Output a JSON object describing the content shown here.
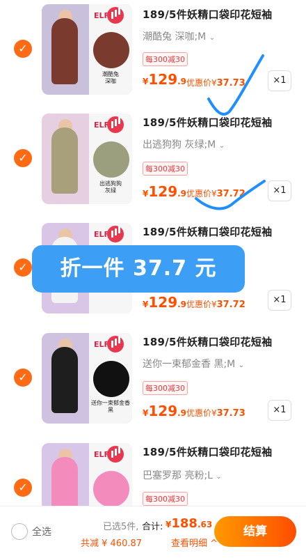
{
  "items": [
    {
      "title": "189/5件妖精口袋印花短袖",
      "spec": "潮酷兔 深咖;M",
      "promo": "每300减30",
      "price_currency": "¥",
      "price_int": "129",
      "price_dec": ".9",
      "discount_label": "优惠价¥",
      "discount_val": "37.73",
      "qty": "×1",
      "thumb_caption": "潮酷兔\n深咖",
      "brand": "ELF",
      "shirt_color": "#7a3b2e",
      "circle_color": "#7a3b2e",
      "bg_color": "#c9c0dc"
    },
    {
      "title": "189/5件妖精口袋印花短袖",
      "spec": "出逃狗狗 灰绿;M",
      "promo": "每300减30",
      "price_currency": "¥",
      "price_int": "129",
      "price_dec": ".9",
      "discount_label": "优惠价¥",
      "discount_val": "37.72",
      "qty": "×1",
      "thumb_caption": "出逃狗狗\n灰绿",
      "brand": "ELF",
      "shirt_color": "#a7a07a",
      "circle_color": "#9c9f7e",
      "bg_color": "#e6cfe0"
    },
    {
      "title": "189/5件妖精口袋印花短袖",
      "spec": "",
      "promo": "",
      "price_currency": "¥",
      "price_int": "129",
      "price_dec": ".9",
      "discount_label": "优惠价¥",
      "discount_val": "37.72",
      "qty": "×1",
      "thumb_caption": "",
      "brand": "ELF",
      "shirt_color": "#f3f3f3",
      "circle_color": "#ffffff",
      "bg_color": "#d9c6e6"
    },
    {
      "title": "189/5件妖精口袋印花短袖",
      "spec": "送你一束郁金香 黑;M",
      "promo": "每300减30",
      "price_currency": "¥",
      "price_int": "129",
      "price_dec": ".9",
      "discount_label": "优惠价¥",
      "discount_val": "37.73",
      "qty": "×1",
      "thumb_caption": "送你一束郁金香\n黑",
      "brand": "ELF",
      "shirt_color": "#1e1e1e",
      "circle_color": "#111111",
      "bg_color": "#cfc2e0"
    },
    {
      "title": "189/5件妖精口袋印花短袖",
      "spec": "巴塞罗那 亮粉;L",
      "promo": "每300减30",
      "price_currency": "",
      "price_int": "",
      "price_dec": "",
      "discount_label": "",
      "discount_val": "",
      "qty": "",
      "thumb_caption": "",
      "brand": "ELF",
      "shirt_color": "#f48bbd",
      "circle_color": "#f48bbd",
      "bg_color": "#d8c6e8"
    }
  ],
  "overlay_text": "折一件 37.7 元",
  "footer": {
    "select_all": "全选",
    "selected_count": "已选5件,",
    "total_label": "合计:",
    "total_currency": "¥",
    "total_int": "188",
    "total_dec": ".63",
    "savings": "共减 ¥ 460.87",
    "details": "查看明细 ^",
    "checkout": "结算"
  },
  "colors": {
    "accent": "#ff5000",
    "check": "#ff6a14",
    "overlay": "#3d9ef5",
    "scribble": "#1f8fff"
  },
  "icons": [
    "check-icon",
    "chevron-down-icon",
    "brand-logo-icon"
  ]
}
